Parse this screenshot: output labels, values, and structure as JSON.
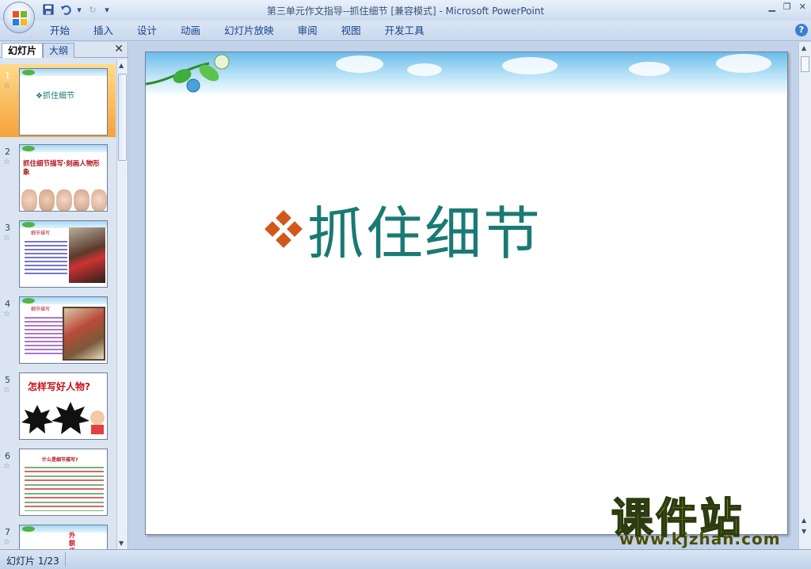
{
  "window": {
    "title": "第三单元作文指导--抓住细节 [兼容模式] - ",
    "app_name": "Microsoft PowerPoint"
  },
  "ribbon": {
    "tabs": [
      "开始",
      "插入",
      "设计",
      "动画",
      "幻灯片放映",
      "审阅",
      "视图",
      "开发工具"
    ],
    "help_label": "?"
  },
  "left_pane": {
    "tab_slides": "幻灯片",
    "tab_outline": "大纲",
    "close_label": "✕",
    "thumbnails": [
      {
        "num": "1",
        "text": "❖抓住细节"
      },
      {
        "num": "2",
        "text": "抓住细节描写·刻画人物形象"
      },
      {
        "num": "3",
        "text": "细节描写"
      },
      {
        "num": "4",
        "text": "细节描写"
      },
      {
        "num": "5",
        "text": "怎样写好人物?"
      },
      {
        "num": "6",
        "text": "什么是细节描写?"
      },
      {
        "num": "7",
        "text": "外貌 语言 动作"
      }
    ]
  },
  "slide": {
    "title": "抓住细节"
  },
  "status": {
    "slide_counter": "幻灯片 1/23"
  },
  "watermark": {
    "brand": "课件站",
    "url": "www.kjzhan.com"
  },
  "colors": {
    "title_teal": "#1a7a74",
    "bullet_orange": "#d1581b",
    "selected_thumb": "#f6a23a"
  }
}
